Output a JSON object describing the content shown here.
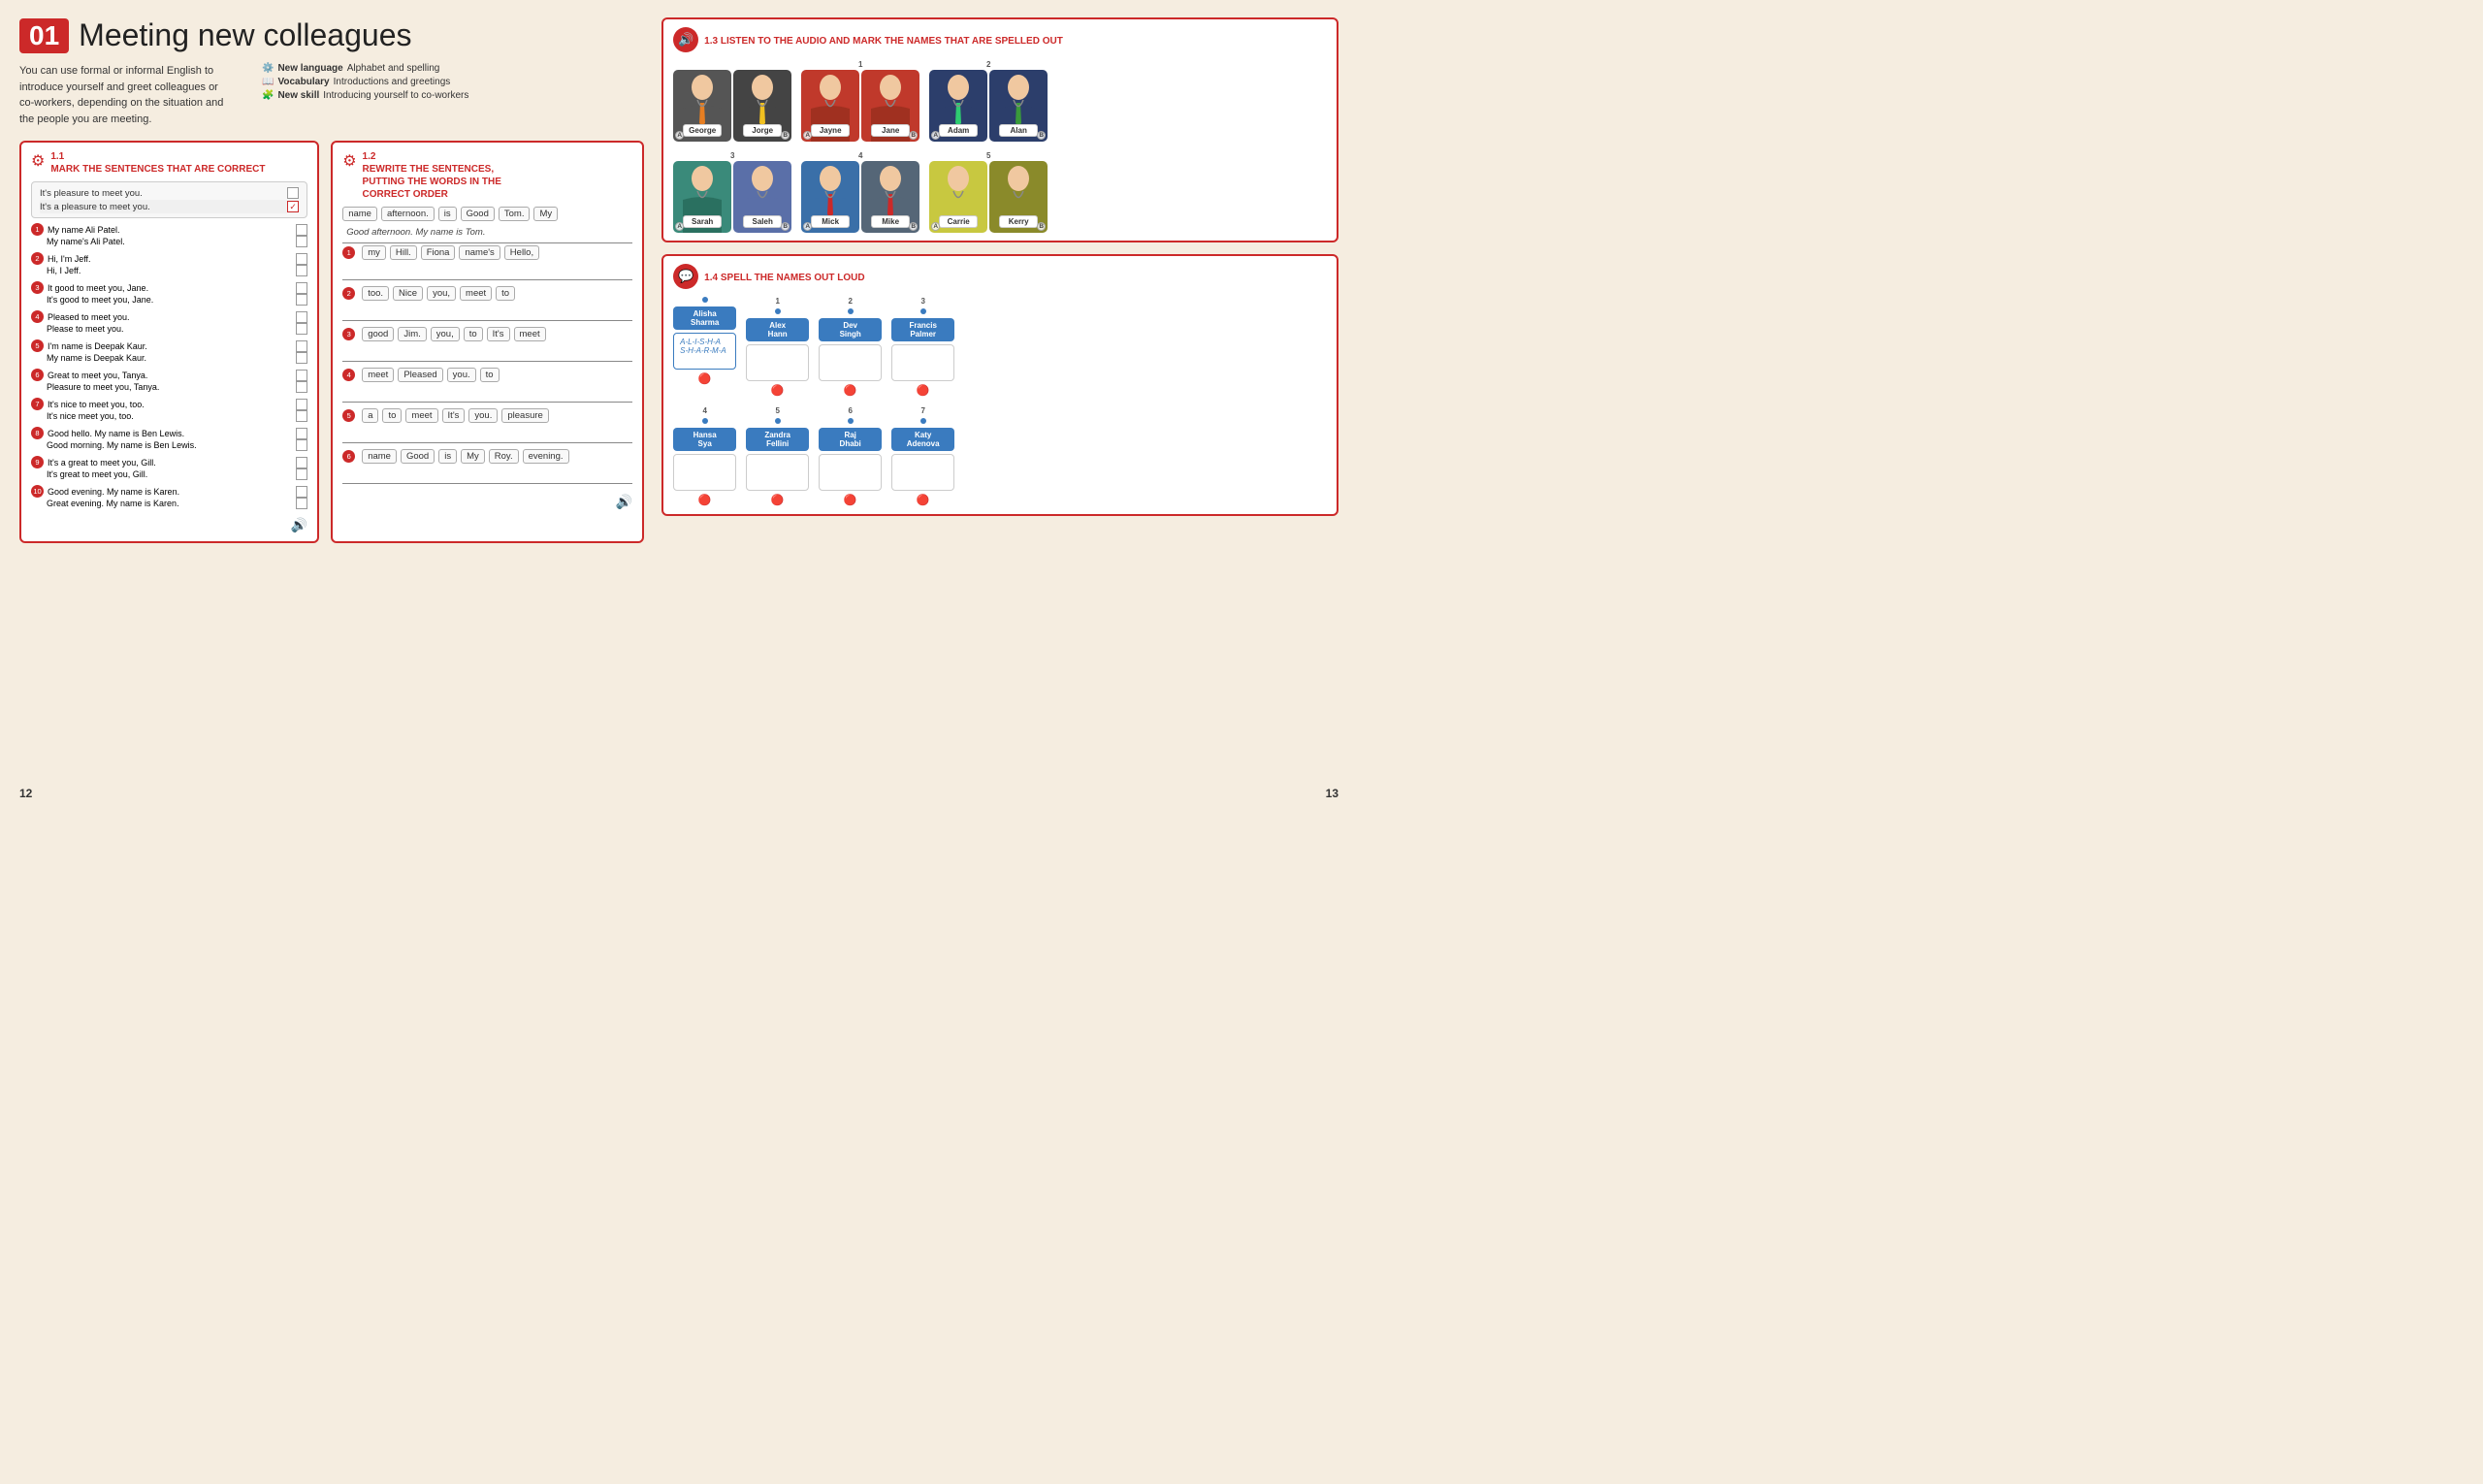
{
  "lesson": {
    "number": "01",
    "title": "Meeting new colleagues",
    "intro": "You can use formal or informal English to introduce yourself and greet colleagues or co-workers, depending on the situation and the people you are meeting.",
    "meta": {
      "new_language_label": "New language",
      "new_language_value": "Alphabet and spelling",
      "vocabulary_label": "Vocabulary",
      "vocabulary_value": "Introductions and greetings",
      "new_skill_label": "New skill",
      "new_skill_value": "Introducing yourself to co-workers"
    }
  },
  "ex11": {
    "number": "1.1",
    "title": "MARK THE SENTENCES THAT ARE CORRECT",
    "top_sentences": [
      {
        "text": "It's pleasure to meet you.",
        "checked": false
      },
      {
        "text": "It's a pleasure to meet you.",
        "checked": true
      }
    ],
    "groups": [
      {
        "num": "1",
        "sentences": [
          "My name Ali Patel.",
          "My name's Ali Patel."
        ]
      },
      {
        "num": "2",
        "sentences": [
          "Hi, I'm Jeff.",
          "Hi, I Jeff."
        ]
      },
      {
        "num": "3",
        "sentences": [
          "It good to meet you, Jane.",
          "It's good to meet you, Jane."
        ]
      },
      {
        "num": "4",
        "sentences": [
          "Pleased to meet you.",
          "Please to meet you."
        ]
      },
      {
        "num": "5",
        "sentences": [
          "I'm name is Deepak Kaur.",
          "My name is Deepak Kaur."
        ]
      },
      {
        "num": "6",
        "sentences": [
          "Great to meet you, Tanya.",
          "Pleasure to meet you, Tanya."
        ]
      },
      {
        "num": "7",
        "sentences": [
          "It's nice to meet you, too.",
          "It's nice meet you, too."
        ]
      },
      {
        "num": "8",
        "sentences": [
          "Good hello. My name is Ben Lewis.",
          "Good morning. My name is Ben Lewis."
        ]
      },
      {
        "num": "9",
        "sentences": [
          "It's a great to meet you, Gill.",
          "It's great to meet you, Gill."
        ]
      },
      {
        "num": "10",
        "sentences": [
          "Good evening. My name is Karen.",
          "Great evening. My name is Karen."
        ]
      }
    ]
  },
  "ex12": {
    "number": "1.2",
    "title": "REWRITE THE SENTENCES, PUTTING THE WORDS IN THE CORRECT ORDER",
    "example_words": [
      "name",
      "afternoon.",
      "is",
      "Good",
      "Tom.",
      "My"
    ],
    "example_answer": "Good afternoon. My name is Tom.",
    "groups": [
      {
        "num": "1",
        "words": [
          "my",
          "Hill.",
          "Fiona",
          "name's",
          "Hello,"
        ],
        "answer": ""
      },
      {
        "num": "2",
        "words": [
          "too.",
          "Nice",
          "you,",
          "meet",
          "to"
        ],
        "answer": ""
      },
      {
        "num": "3",
        "words": [
          "good",
          "Jim.",
          "you,",
          "to",
          "It's",
          "meet"
        ],
        "answer": ""
      },
      {
        "num": "4",
        "words": [
          "meet",
          "Pleased",
          "you.",
          "to"
        ],
        "answer": ""
      },
      {
        "num": "5",
        "words": [
          "a",
          "to",
          "meet",
          "It's",
          "you.",
          "pleasure"
        ],
        "answer": ""
      },
      {
        "num": "6",
        "words": [
          "name",
          "Good",
          "is",
          "My",
          "Roy.",
          "evening."
        ],
        "answer": ""
      }
    ]
  },
  "ex13": {
    "number": "1.3",
    "title": "LISTEN TO THE AUDIO AND MARK THE NAMES THAT ARE SPELLED OUT",
    "pairs": [
      {
        "group_num": "",
        "cards": [
          {
            "name": "George",
            "bg": "#555",
            "tie": "orange",
            "label": "A"
          },
          {
            "name": "Jorge",
            "bg": "#444",
            "tie": "gold",
            "label": "B"
          }
        ]
      },
      {
        "group_num": "1",
        "cards": [
          {
            "name": "Jayne",
            "bg": "#c0392b",
            "tie": "none",
            "label": "A"
          },
          {
            "name": "Jane",
            "bg": "#c0392b",
            "tie": "none",
            "label": "B"
          }
        ]
      },
      {
        "group_num": "2",
        "cards": [
          {
            "name": "Adam",
            "bg": "#2c3e6b",
            "tie": "green",
            "label": "A"
          },
          {
            "name": "Alan",
            "bg": "#2c3e6b",
            "tie": "green",
            "label": "B"
          }
        ]
      },
      {
        "group_num": "3",
        "cards": [
          {
            "name": "Sarah",
            "bg": "#2b8a8a",
            "tie": "none",
            "label": "A"
          },
          {
            "name": "Saleh",
            "bg": "#3a6fa8",
            "tie": "none",
            "label": "B"
          }
        ]
      },
      {
        "group_num": "4",
        "cards": [
          {
            "name": "Mick",
            "bg": "#3a6fa8",
            "tie": "red",
            "label": "A"
          },
          {
            "name": "Mike",
            "bg": "#555",
            "tie": "red",
            "label": "B"
          }
        ]
      },
      {
        "group_num": "5",
        "cards": [
          {
            "name": "Carrie",
            "bg": "#b8b840",
            "tie": "none",
            "label": "A"
          },
          {
            "name": "Kerry",
            "bg": "#7a7a2a",
            "tie": "none",
            "label": "B"
          }
        ]
      }
    ]
  },
  "ex14": {
    "number": "1.4",
    "title": "SPELL THE NAMES OUT LOUD",
    "names": [
      {
        "name": "Alisha\nSharma",
        "spelling": "A-L-I-S-H-A\nS-H-A-R-M-A",
        "num": ""
      },
      {
        "name": "Alex\nHann",
        "spelling": "",
        "num": "1"
      },
      {
        "name": "Dev\nSingh",
        "spelling": "",
        "num": "2"
      },
      {
        "name": "Francis\nPalmer",
        "spelling": "",
        "num": "3"
      },
      {
        "name": "Hansa\nSya",
        "spelling": "",
        "num": "4"
      },
      {
        "name": "Zandra\nFellini",
        "spelling": "",
        "num": "5"
      },
      {
        "name": "Raj\nDhabi",
        "spelling": "",
        "num": "6"
      },
      {
        "name": "Katy\nAdenova",
        "spelling": "",
        "num": "7"
      }
    ]
  },
  "pages": {
    "left": "12",
    "right": "13"
  }
}
